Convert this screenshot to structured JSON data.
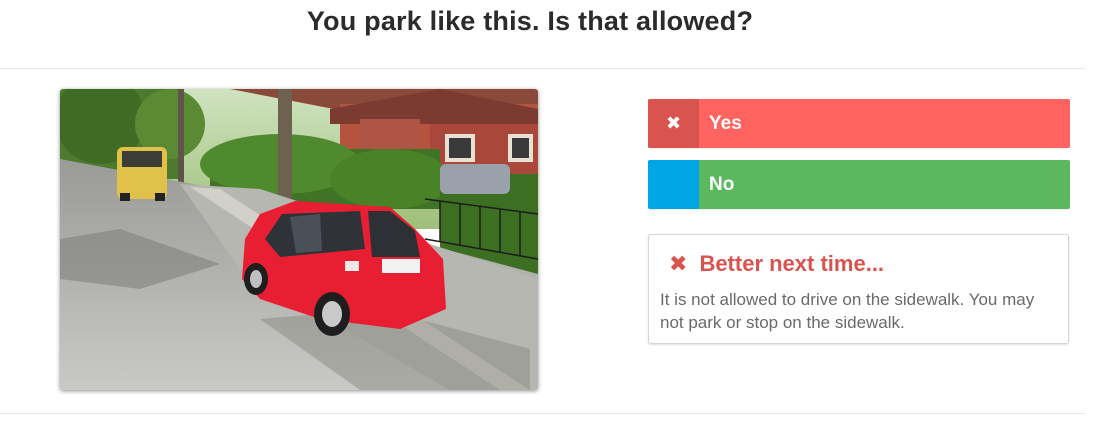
{
  "question": {
    "title": "You park like this. Is that allowed?"
  },
  "image": {
    "subject": "red-hatchback-on-sidewalk"
  },
  "answers": [
    {
      "label": "Yes",
      "marker": "✖",
      "state": "selected-wrong"
    },
    {
      "label": "No",
      "marker": "",
      "state": "correct"
    }
  ],
  "feedback": {
    "icon": "✖",
    "heading": "Better next time...",
    "text": "It is not allowed to drive on the sidewalk. You may not park or stop on the sidewalk."
  },
  "colors": {
    "wrong": "#ff6461",
    "wrong_marker": "#d9534f",
    "correct": "#5cb85c",
    "correct_marker": "#00a5e6"
  }
}
